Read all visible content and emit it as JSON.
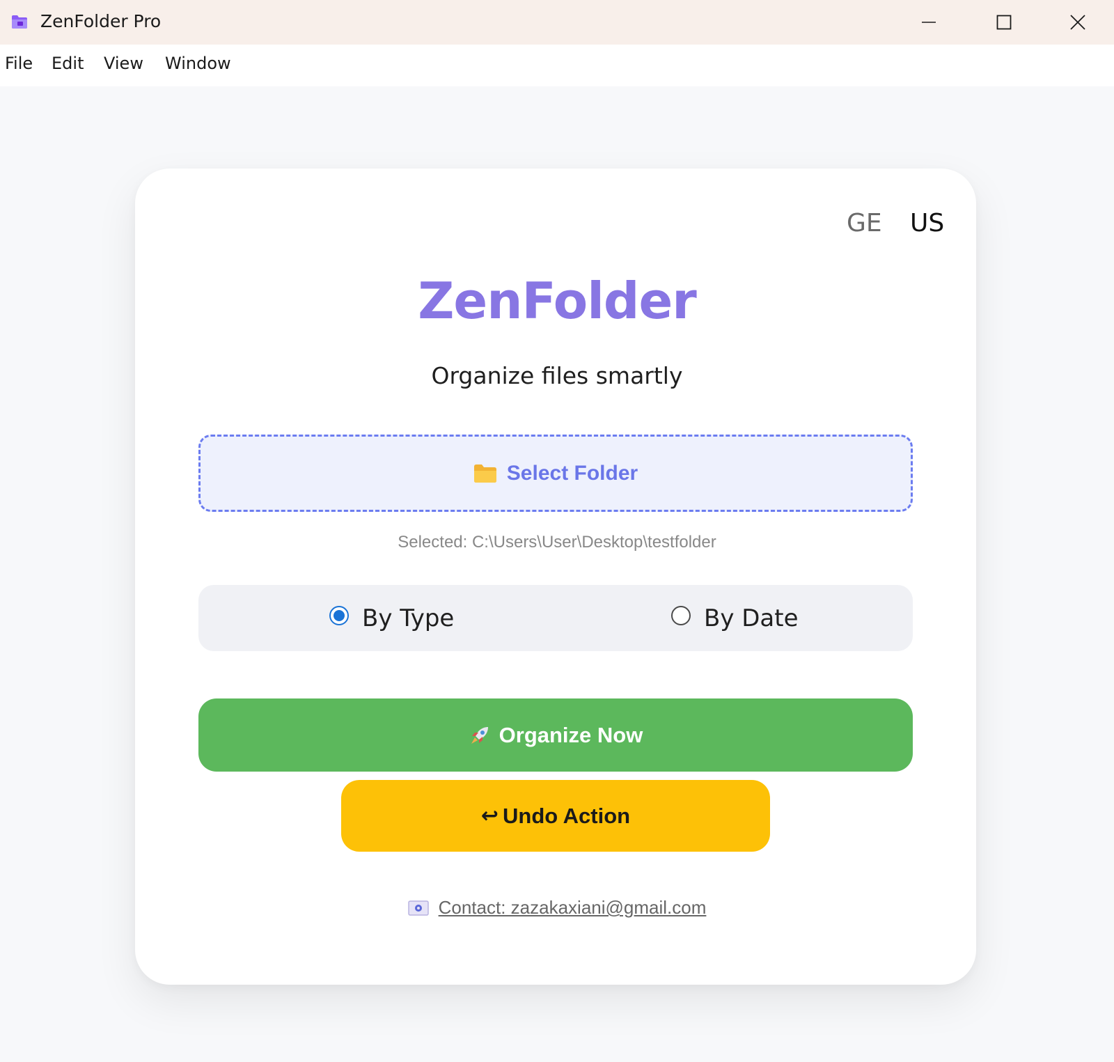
{
  "window": {
    "title": "ZenFolder Pro",
    "icon": "folder-app-icon",
    "controls": [
      "minimize-icon",
      "maximize-icon",
      "close-icon"
    ]
  },
  "menu": {
    "file": "File",
    "edit": "Edit",
    "view": "View",
    "window": "Window"
  },
  "language": {
    "ge": "GE",
    "us": "US",
    "active": "US"
  },
  "header": {
    "brand": "ZenFolder",
    "subtitle": "Organize files smartly"
  },
  "folder": {
    "button_label": "Select Folder",
    "icon": "folder-icon",
    "selected_text": "Selected: C:\\Users\\User\\Desktop\\testfolder"
  },
  "mode": {
    "by_type": "By Type",
    "by_date": "By Date",
    "selected": "By Type"
  },
  "actions": {
    "organize_label": "Organize Now",
    "organize_icon": "rocket-icon",
    "undo_label": "Undo Action",
    "undo_icon": "undo-arrow-icon"
  },
  "contact": {
    "text": "Contact: zazakaxiani@gmail.com",
    "icon": "email-icon"
  },
  "colors": {
    "brand": "#8876e3",
    "organize": "#5cb85c",
    "undo": "#fdc107",
    "folder_border": "#6b7cf0",
    "radio_accent": "#1a73d6",
    "titlebar": "#f8efea"
  }
}
